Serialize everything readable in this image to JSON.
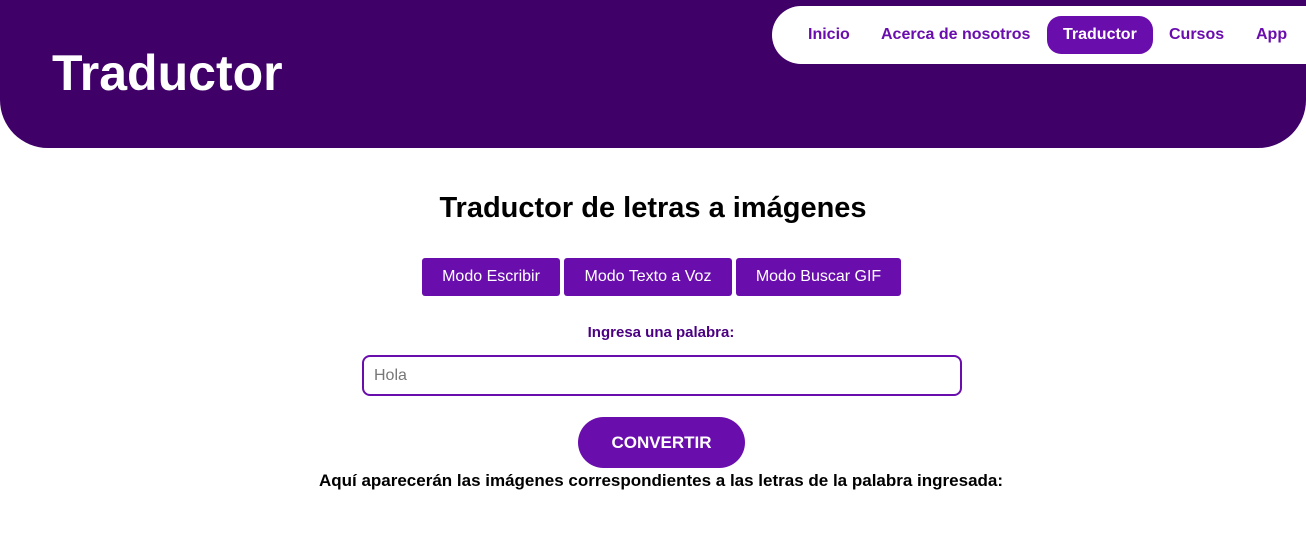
{
  "header": {
    "title": "Traductor",
    "nav": [
      {
        "label": "Inicio"
      },
      {
        "label": "Acerca de nosotros"
      },
      {
        "label": "Traductor",
        "active": true
      },
      {
        "label": "Cursos"
      },
      {
        "label": "App"
      }
    ]
  },
  "main": {
    "title": "Traductor de letras a imágenes",
    "modes": [
      {
        "label": "Modo Escribir"
      },
      {
        "label": "Modo Texto a Voz"
      },
      {
        "label": "Modo Buscar GIF"
      }
    ],
    "input_label": "Ingresa una palabra:",
    "input_placeholder": "Hola",
    "input_value": "",
    "convert_label": "CONVERTIR",
    "result_text": "Aquí aparecerán las imágenes correspondientes a las letras de la palabra ingresada:"
  },
  "colors": {
    "header_bg": "#3f0068",
    "accent": "#6a0dad",
    "label": "#4b0082"
  }
}
